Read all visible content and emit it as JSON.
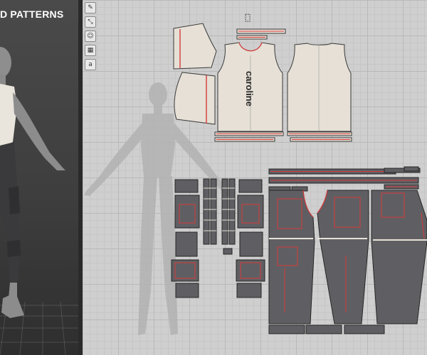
{
  "viewport3d": {
    "title": "D PATTERNS"
  },
  "toolbar": {
    "tools": [
      {
        "name": "pen-tool-icon",
        "glyph": "✎"
      },
      {
        "name": "transform-tool-icon",
        "glyph": "⤡"
      },
      {
        "name": "avatar-tool-icon",
        "glyph": "☺"
      },
      {
        "name": "texture-tool-icon",
        "glyph": "▦"
      },
      {
        "name": "text-tool-icon",
        "glyph": "a"
      }
    ]
  },
  "pattern": {
    "front_print": "caroline"
  },
  "colors": {
    "fabric_top": "#e6e0d6",
    "fabric_pants": "#5f5f63",
    "seam_red": "#d83a3a",
    "grid": "#cfcfcf"
  }
}
